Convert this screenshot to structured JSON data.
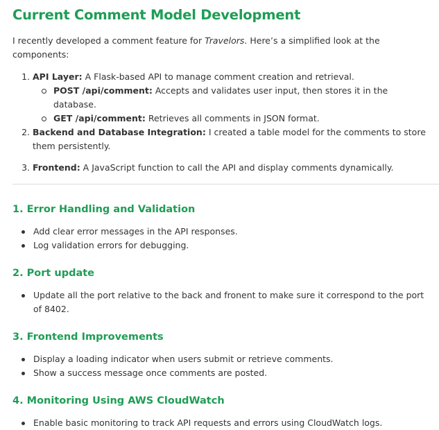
{
  "title": "Current Comment Model Development",
  "intro": {
    "before": "I recently developed a comment feature for ",
    "emphasis": "Travelors",
    "after": ". Here’s a simplified look at the components:"
  },
  "components": [
    {
      "number": "1.",
      "label": "API Layer:",
      "text": " A Flask-based API to manage comment creation and retrieval."
    },
    {
      "number": "2.",
      "label": "Backend and Database Integration:",
      "text": " I created a table model for the comments to store them persistently."
    },
    {
      "number": "3.",
      "label": "Frontend:",
      "text": " A JavaScript function to call the API and display comments dynamically."
    }
  ],
  "api_sub": [
    {
      "label": "POST /api/comment:",
      "text": " Accepts and validates user input, then stores it in the database."
    },
    {
      "label": "GET /api/comment:",
      "text": " Retrieves all comments in JSON format."
    }
  ],
  "sections": [
    {
      "heading": "1. Error Handling and Validation",
      "bullets": [
        "Add clear error messages in the API responses.",
        "Log validation errors for debugging."
      ]
    },
    {
      "heading": "2. Port update",
      "bullets": [
        "Update all the port relative to the back and fronent to make sure it correspond to the port of 8402."
      ]
    },
    {
      "heading": "3. Frontend Improvements",
      "bullets": [
        "Display a loading indicator when users submit or retrieve comments.",
        "Show a success message once comments are posted."
      ]
    },
    {
      "heading": "4. Monitoring Using AWS CloudWatch",
      "bullets": [
        "Enable basic monitoring to track API requests and errors using CloudWatch logs."
      ]
    }
  ],
  "colors": {
    "heading": "#1f9d55",
    "text": "#333333"
  }
}
